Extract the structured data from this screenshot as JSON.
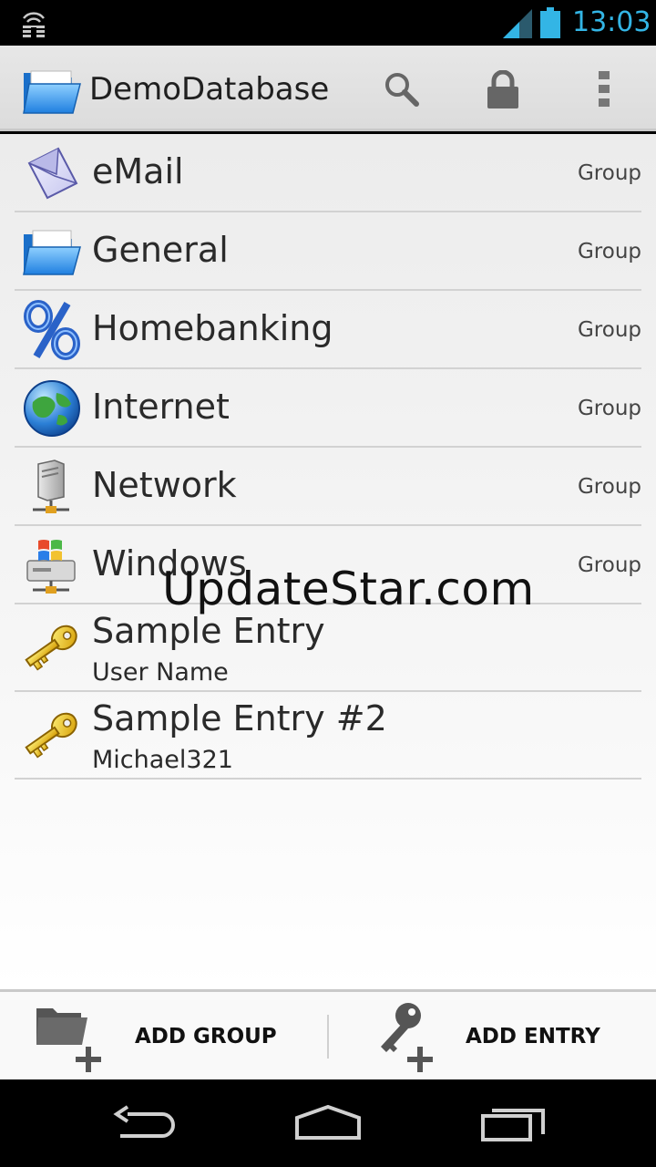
{
  "status_bar": {
    "time": "13:03",
    "colors": {
      "accent": "#33b5e5"
    }
  },
  "action_bar": {
    "title": "DemoDatabase",
    "icons": [
      "folder-open-icon",
      "search-icon",
      "lock-icon",
      "overflow-menu-icon"
    ]
  },
  "groups": [
    {
      "title": "eMail",
      "badge": "Group",
      "icon": "email-envelope-icon"
    },
    {
      "title": "General",
      "badge": "Group",
      "icon": "folder-open-icon"
    },
    {
      "title": "Homebanking",
      "badge": "Group",
      "icon": "percent-icon"
    },
    {
      "title": "Internet",
      "badge": "Group",
      "icon": "globe-icon"
    },
    {
      "title": "Network",
      "badge": "Group",
      "icon": "network-server-icon"
    },
    {
      "title": "Windows",
      "badge": "Group",
      "icon": "windows-computer-icon"
    }
  ],
  "entries": [
    {
      "title": "Sample Entry",
      "subtitle": "User Name",
      "icon": "key-icon"
    },
    {
      "title": "Sample Entry #2",
      "subtitle": "Michael321",
      "icon": "key-icon"
    }
  ],
  "watermark": "UpdateStar.com",
  "bottom_bar": {
    "add_group_label": "ADD GROUP",
    "add_entry_label": "ADD ENTRY"
  },
  "nav_bar": {
    "icons": [
      "back-icon",
      "home-icon",
      "recents-icon"
    ]
  }
}
